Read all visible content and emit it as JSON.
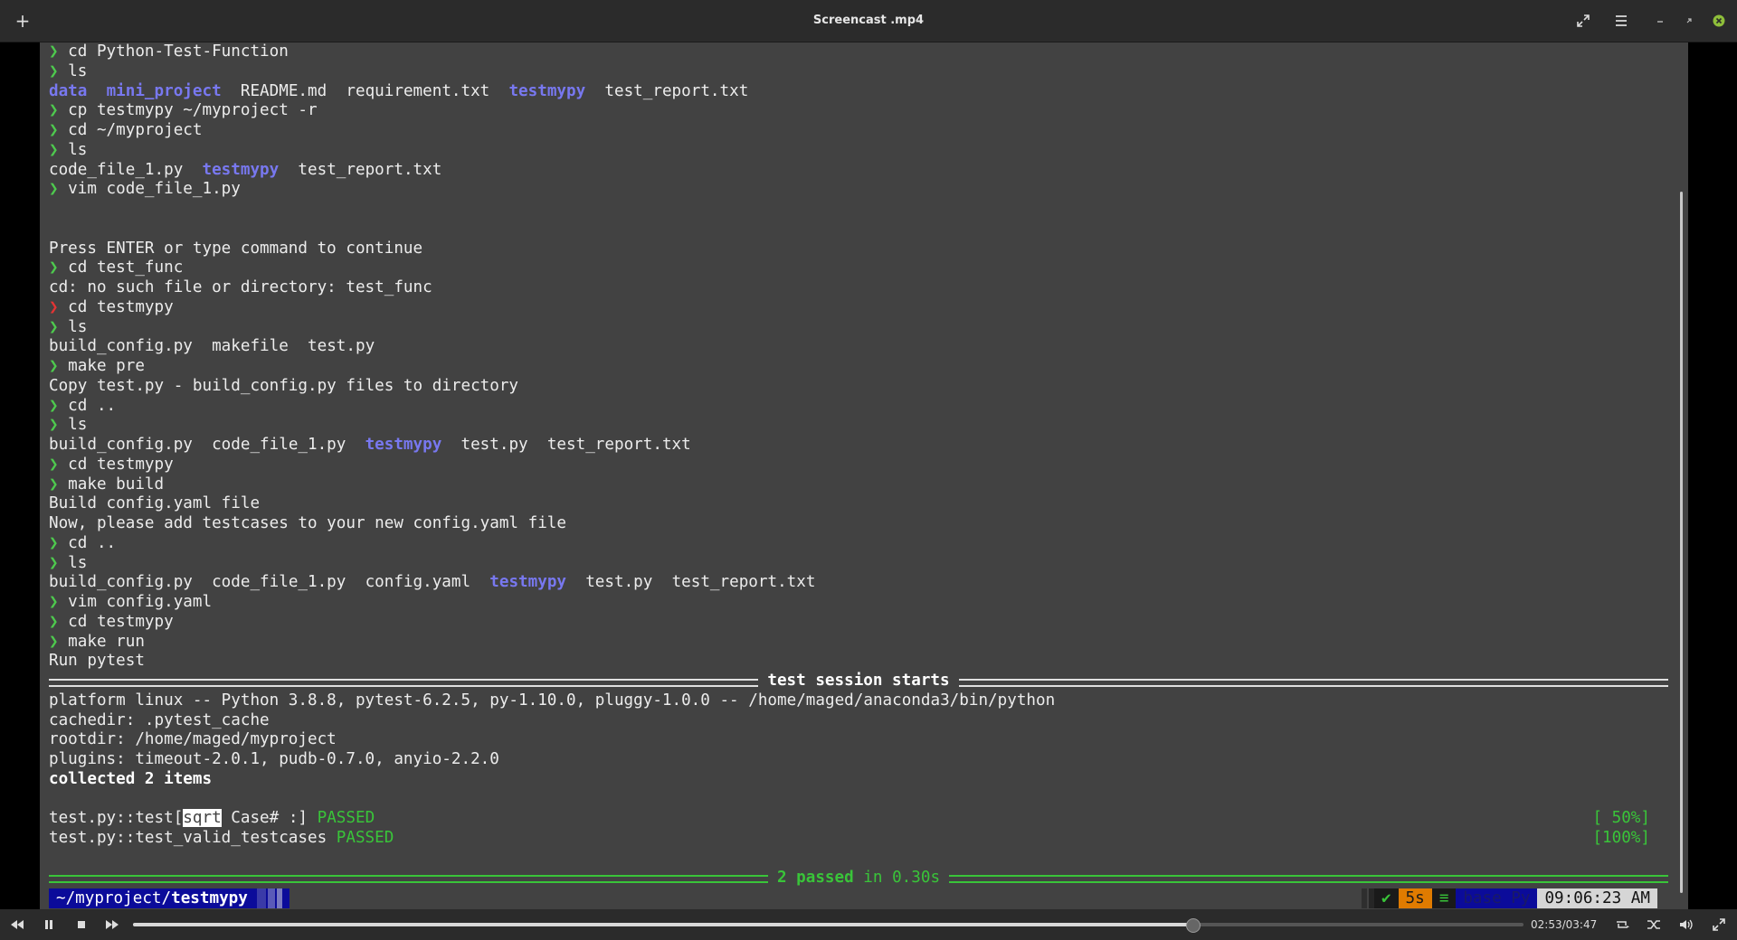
{
  "window": {
    "title": "Screencast .mp4",
    "new_tab_label": "+"
  },
  "terminal": {
    "lines": [
      {
        "p": "❯",
        "t": " cd Python-Test-Function"
      },
      {
        "p": "❯",
        "t": " ls"
      },
      {
        "ls": [
          "data",
          "mini_project",
          "README.md",
          "requirement.txt",
          "testmypy",
          "test_report.txt"
        ],
        "dirs": [
          0,
          1,
          4
        ]
      },
      {
        "p": "❯",
        "t": " cp testmypy ~/myproject -r"
      },
      {
        "p": "❯",
        "t": " cd ~/myproject"
      },
      {
        "p": "❯",
        "t": " ls"
      },
      {
        "ls": [
          "code_file_1.py",
          "testmypy",
          "test_report.txt"
        ],
        "dirs": [
          1
        ]
      },
      {
        "p": "❯",
        "t": " vim code_file_1.py"
      },
      {
        "t": ""
      },
      {
        "t": ""
      },
      {
        "t": "Press ENTER or type command to continue"
      },
      {
        "p": "❯",
        "t": " cd test_func"
      },
      {
        "t": "cd: no such file or directory: test_func"
      },
      {
        "p": "❯",
        "err": true,
        "t": " cd testmypy"
      },
      {
        "p": "❯",
        "t": " ls"
      },
      {
        "ls": [
          "build_config.py",
          "makefile",
          "test.py"
        ],
        "dirs": []
      },
      {
        "p": "❯",
        "t": " make pre"
      },
      {
        "t": "Copy test.py - build_config.py files to directory"
      },
      {
        "p": "❯",
        "t": " cd .."
      },
      {
        "p": "❯",
        "t": " ls"
      },
      {
        "ls": [
          "build_config.py",
          "code_file_1.py",
          "testmypy",
          "test.py",
          "test_report.txt"
        ],
        "dirs": [
          2
        ]
      },
      {
        "p": "❯",
        "t": " cd testmypy"
      },
      {
        "p": "❯",
        "t": " make build"
      },
      {
        "t": "Build config.yaml file"
      },
      {
        "t": "Now, please add testcases to your new config.yaml file"
      },
      {
        "p": "❯",
        "t": " cd .."
      },
      {
        "p": "❯",
        "t": " ls"
      },
      {
        "ls": [
          "build_config.py",
          "code_file_1.py",
          "config.yaml",
          "testmypy",
          "test.py",
          "test_report.txt"
        ],
        "dirs": [
          3
        ]
      },
      {
        "p": "❯",
        "t": " vim config.yaml"
      },
      {
        "p": "❯",
        "t": " cd testmypy"
      },
      {
        "p": "❯",
        "t": " make run"
      },
      {
        "t": "Run pytest"
      }
    ],
    "session_header": "test session starts",
    "info_lines": [
      "platform linux -- Python 3.8.8, pytest-6.2.5, py-1.10.0, pluggy-1.0.0 -- /home/maged/anaconda3/bin/python",
      "cachedir: .pytest_cache",
      "rootdir: /home/maged/myproject",
      "plugins: timeout-2.0.1, pudb-0.7.0, anyio-2.2.0"
    ],
    "collected": "collected 2 items",
    "tests": [
      {
        "pre": "test.py::test[",
        "hl": "sqrt",
        "post": " Case# :]",
        "status": "PASSED",
        "progress": "[ 50%]"
      },
      {
        "pre": "test.py::test_valid_testcases",
        "hl": "",
        "post": "",
        "status": "PASSED",
        "progress": "[100%]"
      }
    ],
    "summary_passed": "2 passed",
    "summary_time": "in 0.30s",
    "prompt_path_prefix": "~/myproject/",
    "prompt_path_dir": "testmypy",
    "status_check": "✔",
    "status_duration": "5s",
    "status_env_icon": "≡",
    "status_env": "base Py",
    "status_time": "09:06:23 AM"
  },
  "player": {
    "time_label": "02:53/03:47",
    "progress_fraction": 0.762
  },
  "colors": {
    "terminal_bg": "#424242",
    "prompt_green": "#4ec94e",
    "dir_blue": "#7878f0",
    "pass_green": "#39c439"
  }
}
